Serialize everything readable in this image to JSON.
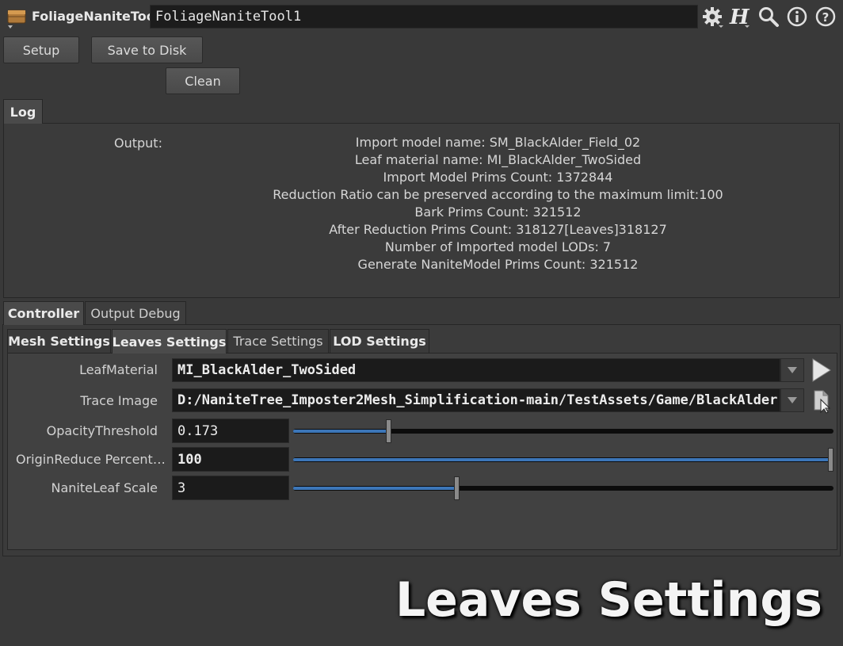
{
  "header": {
    "node_type": "FoliageNaniteTool",
    "node_name": "FoliageNaniteTool1",
    "icons": [
      "gear-icon",
      "houdini-help-icon",
      "search-icon",
      "info-icon",
      "help-icon"
    ]
  },
  "buttons": {
    "setup": "Setup",
    "save_to_disk": "Save to Disk",
    "clean": "Clean"
  },
  "log": {
    "tab": "Log",
    "label": "Output:",
    "lines": [
      "Import model name: SM_BlackAlder_Field_02",
      "Leaf material name: MI_BlackAlder_TwoSided",
      "Import Model Prims Count: 1372844",
      "Reduction Ratio can be preserved according to the maximum limit:100",
      "Bark Prims Count: 321512",
      "After Reduction Prims Count: 318127[Leaves]318127",
      "Number of Imported model LODs: 7",
      "Generate NaniteModel Prims Count: 321512"
    ]
  },
  "main_tabs": [
    {
      "label": "Controller",
      "active": true
    },
    {
      "label": "Output Debug",
      "active": false
    }
  ],
  "sub_tabs": [
    {
      "label": "Mesh Settings",
      "active": false
    },
    {
      "label": "Leaves Settings",
      "active": true
    },
    {
      "label": "Trace Settings",
      "active": false
    },
    {
      "label": "LOD Settings",
      "active": false
    }
  ],
  "params": {
    "leaf_material": {
      "label": "LeafMaterial",
      "value": "MI_BlackAlder_TwoSided"
    },
    "trace_image": {
      "label": "Trace Image",
      "value": "D:/NaniteTree_Imposter2Mesh_Simplification-main/TestAssets/Game/BlackAlder"
    },
    "opacity_threshold": {
      "label": "OpacityThreshold",
      "value": "0.173",
      "slider_fraction": 0.173
    },
    "origin_reduce_percent": {
      "label": "OriginReduce Percent…",
      "value": "100",
      "slider_fraction": 1.0
    },
    "nanite_leaf_scale": {
      "label": "NaniteLeaf Scale",
      "value": "3",
      "slider_fraction": 0.3
    }
  },
  "overlay_title": "Leaves Settings",
  "colors": {
    "background": "#393939",
    "field": "#1b1b1b",
    "slider_fill": "#3c76b8"
  }
}
